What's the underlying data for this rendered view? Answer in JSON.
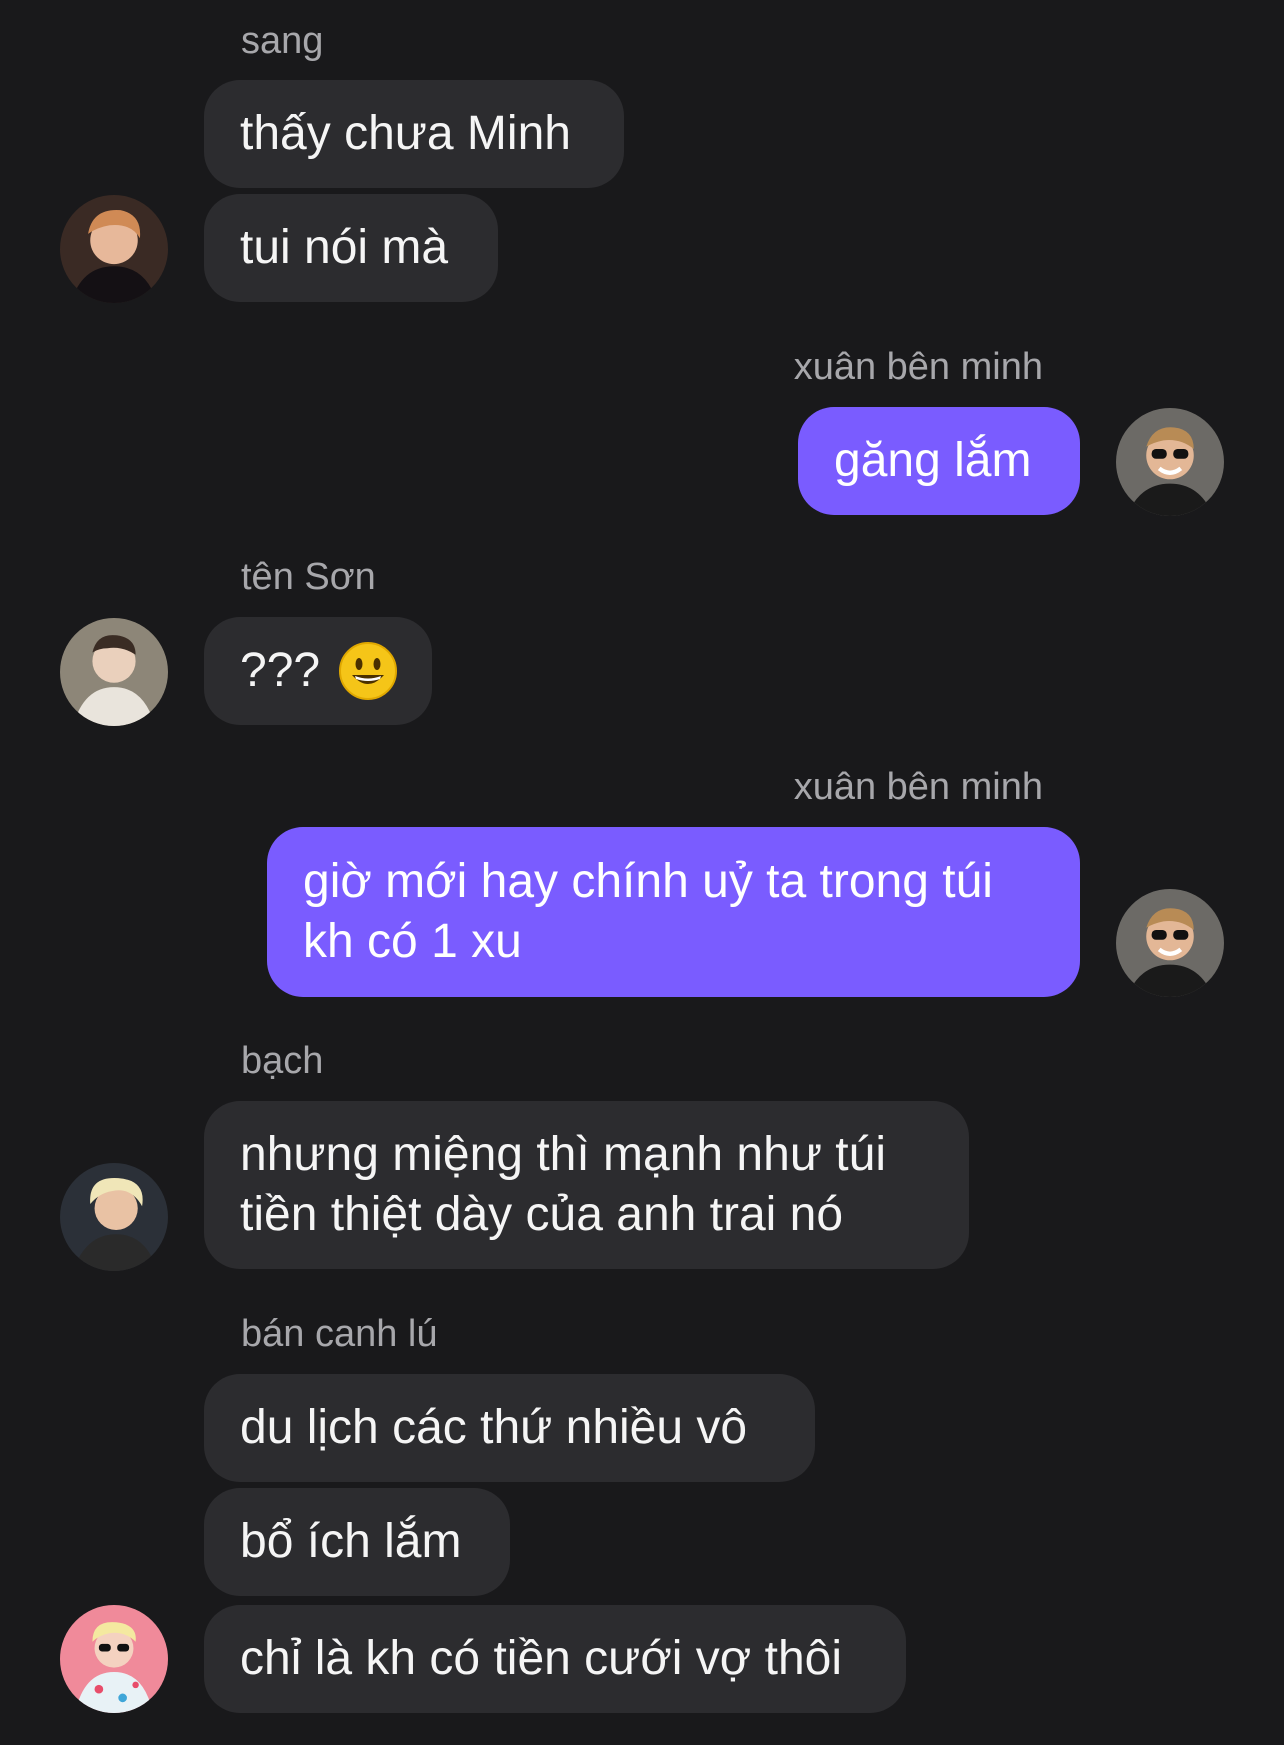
{
  "colors": {
    "background": "#19191b",
    "incoming_bubble": "#2c2c2f",
    "outgoing_bubble": "#7a5cff",
    "sender_name": "#a7a7ab"
  },
  "messages": [
    {
      "sender": "sang",
      "lines": [
        "thấy chưa Minh",
        "tui nói mà"
      ]
    },
    {
      "sender": "xuân bên minh",
      "lines": [
        "găng lắm"
      ]
    },
    {
      "sender": "tên Sơn",
      "lines": [
        "???"
      ],
      "emoji": "grinning-face-emoji"
    },
    {
      "sender": "xuân bên minh",
      "lines": [
        "giờ mới hay chính uỷ ta trong túi kh có 1 xu"
      ]
    },
    {
      "sender": "bạch",
      "lines": [
        "nhưng miệng thì mạnh như túi tiền thiệt dày của anh trai nó"
      ]
    },
    {
      "sender": "bán canh lú",
      "lines": [
        "du lịch các thứ nhiều vô",
        "bổ ích lắm",
        "chỉ là kh có tiền cưới vợ thôi"
      ]
    }
  ]
}
